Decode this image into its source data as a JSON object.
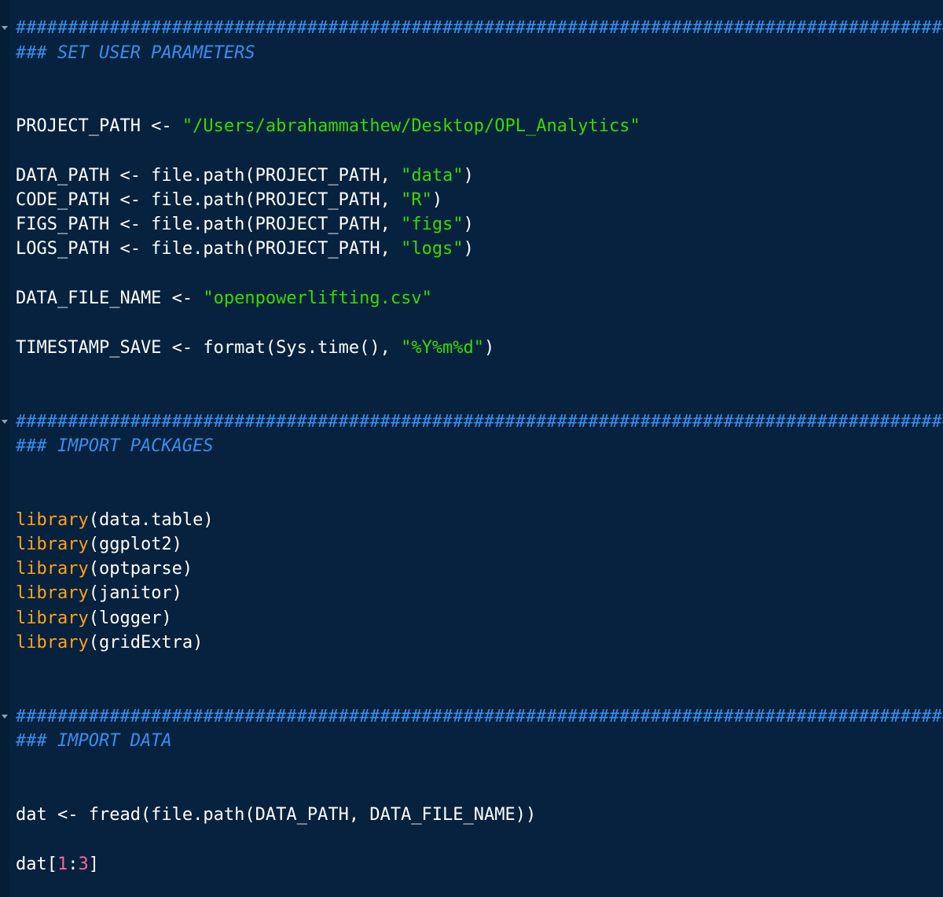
{
  "editor": {
    "hash_bar": "######################################################################################################",
    "sections": [
      {
        "heading": "### SET USER PARAMETERS",
        "lines": [
          {
            "name": "project-path-line",
            "parts": [
              {
                "t": "PROJECT_PATH <- "
              },
              {
                "t": "\"/Users/abrahammathew/Desktop/OPL_Analytics\"",
                "c": "str"
              }
            ]
          },
          {
            "name": "data-path-line",
            "parts": [
              {
                "t": "DATA_PATH <- file.path(PROJECT_PATH, "
              },
              {
                "t": "\"data\"",
                "c": "str"
              },
              {
                "t": ")"
              }
            ]
          },
          {
            "name": "code-path-line",
            "parts": [
              {
                "t": "CODE_PATH <- file.path(PROJECT_PATH, "
              },
              {
                "t": "\"R\"",
                "c": "str"
              },
              {
                "t": ")"
              }
            ]
          },
          {
            "name": "figs-path-line",
            "parts": [
              {
                "t": "FIGS_PATH <- file.path(PROJECT_PATH, "
              },
              {
                "t": "\"figs\"",
                "c": "str"
              },
              {
                "t": ")"
              }
            ]
          },
          {
            "name": "logs-path-line",
            "parts": [
              {
                "t": "LOGS_PATH <- file.path(PROJECT_PATH, "
              },
              {
                "t": "\"logs\"",
                "c": "str"
              },
              {
                "t": ")"
              }
            ]
          },
          {
            "name": "data-file-name-line",
            "parts": [
              {
                "t": "DATA_FILE_NAME <- "
              },
              {
                "t": "\"openpowerlifting.csv\"",
                "c": "str"
              }
            ]
          },
          {
            "name": "timestamp-save-line",
            "parts": [
              {
                "t": "TIMESTAMP_SAVE <- format(Sys.time(), "
              },
              {
                "t": "\"%Y%m%d\"",
                "c": "str"
              },
              {
                "t": ")"
              }
            ]
          }
        ]
      },
      {
        "heading": "### IMPORT PACKAGES",
        "lines": [
          {
            "name": "library-data-table-line",
            "parts": [
              {
                "t": "library",
                "c": "kw"
              },
              {
                "t": "(data.table)"
              }
            ]
          },
          {
            "name": "library-ggplot2-line",
            "parts": [
              {
                "t": "library",
                "c": "kw"
              },
              {
                "t": "(ggplot2)"
              }
            ]
          },
          {
            "name": "library-optparse-line",
            "parts": [
              {
                "t": "library",
                "c": "kw"
              },
              {
                "t": "(optparse)"
              }
            ]
          },
          {
            "name": "library-janitor-line",
            "parts": [
              {
                "t": "library",
                "c": "kw"
              },
              {
                "t": "(janitor)"
              }
            ]
          },
          {
            "name": "library-logger-line",
            "parts": [
              {
                "t": "library",
                "c": "kw"
              },
              {
                "t": "(logger)"
              }
            ]
          },
          {
            "name": "library-gridextra-line",
            "parts": [
              {
                "t": "library",
                "c": "kw"
              },
              {
                "t": "(gridExtra)"
              }
            ]
          }
        ]
      },
      {
        "heading": "### IMPORT DATA",
        "lines": [
          {
            "name": "fread-line",
            "parts": [
              {
                "t": "dat <- fread(file.path(DATA_PATH, DATA_FILE_NAME))"
              }
            ]
          },
          {
            "name": "dat-subset-line",
            "parts": [
              {
                "t": "dat["
              },
              {
                "t": "1",
                "c": "num"
              },
              {
                "t": ":"
              },
              {
                "t": "3",
                "c": "num"
              },
              {
                "t": "]"
              }
            ]
          }
        ]
      }
    ]
  }
}
